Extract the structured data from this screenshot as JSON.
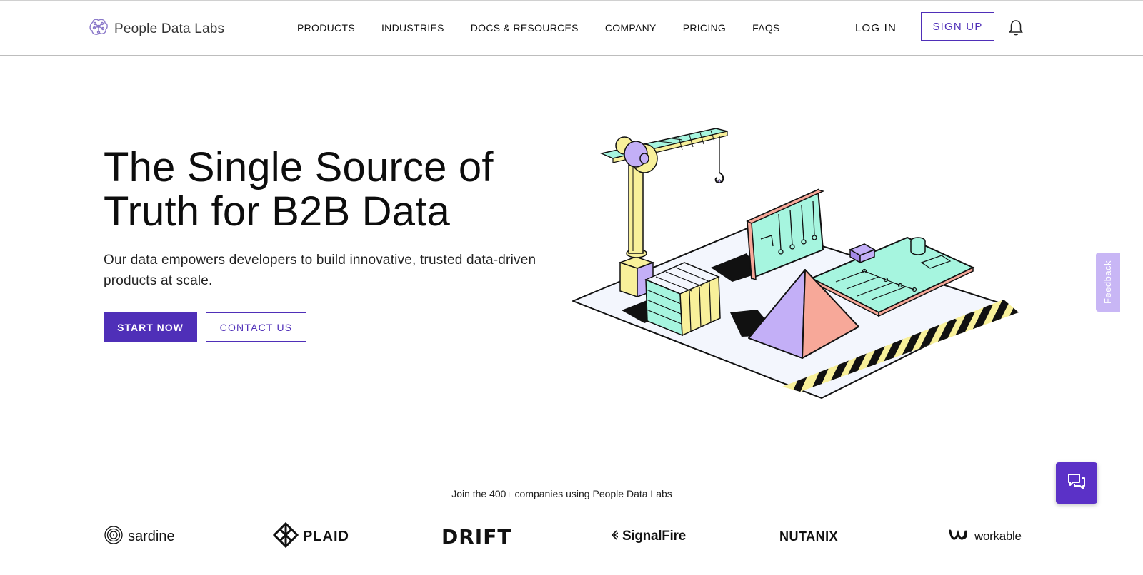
{
  "brand": {
    "name": "People Data Labs"
  },
  "nav": {
    "items": [
      "PRODUCTS",
      "INDUSTRIES",
      "DOCS & RESOURCES",
      "COMPANY",
      "PRICING",
      "FAQS"
    ],
    "login": "LOG IN",
    "signup": "SIGN UP"
  },
  "hero": {
    "title_line1": "The Single Source of",
    "title_line2": "Truth for B2B Data",
    "subtitle": "Our data empowers developers to build innovative, trusted data-driven products at scale.",
    "primary_cta": "START NOW",
    "secondary_cta": "CONTACT US"
  },
  "feedback": {
    "label": "Feedback"
  },
  "customers": {
    "heading": "Join the 400+ companies using People Data Labs",
    "logos": [
      "sardine",
      "PLAID",
      "DRIFT",
      "SignalFire",
      "NUTANIX",
      "workable"
    ]
  },
  "colors": {
    "brand_purple": "#4f2fb8",
    "mint": "#a6f5df",
    "lavender": "#c3aff7",
    "salmon": "#f7a899",
    "yellow": "#f8f09a"
  },
  "icons": [
    "brain-logo-icon",
    "bell-icon",
    "chat-icon"
  ]
}
